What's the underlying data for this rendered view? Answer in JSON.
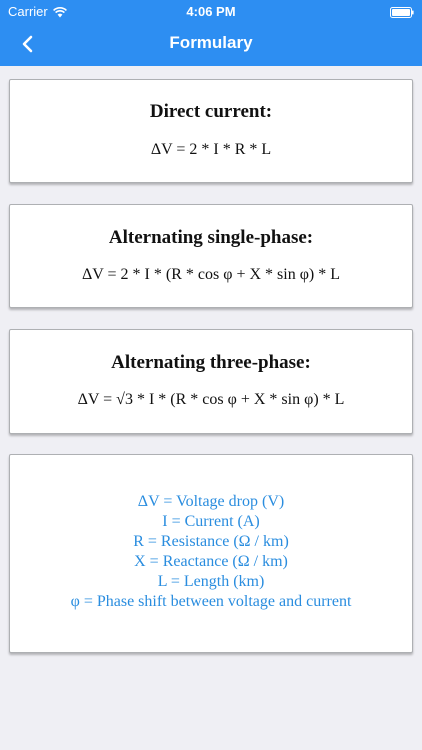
{
  "status_bar": {
    "carrier": "Carrier",
    "time": "4:06 PM"
  },
  "nav": {
    "title": "Formulary",
    "back_icon": "chevron-left-icon"
  },
  "colors": {
    "accent": "#2d8ef2",
    "legend_text": "#2a8ddf",
    "background": "#efeff4"
  },
  "cards": [
    {
      "title": "Direct current:",
      "formula": "ΔV = 2 * I * R * L"
    },
    {
      "title": "Alternating single-phase:",
      "formula": "ΔV = 2 * I * (R * cos φ + X * sin φ) * L"
    },
    {
      "title": "Alternating three-phase:",
      "formula": "ΔV = √3 * I * (R * cos φ + X * sin φ) * L"
    }
  ],
  "legend": [
    "ΔV = Voltage drop (V)",
    "I = Current (A)",
    "R = Resistance (Ω / km)",
    "X = Reactance (Ω / km)",
    "L = Length (km)",
    "φ = Phase shift between voltage and current"
  ]
}
